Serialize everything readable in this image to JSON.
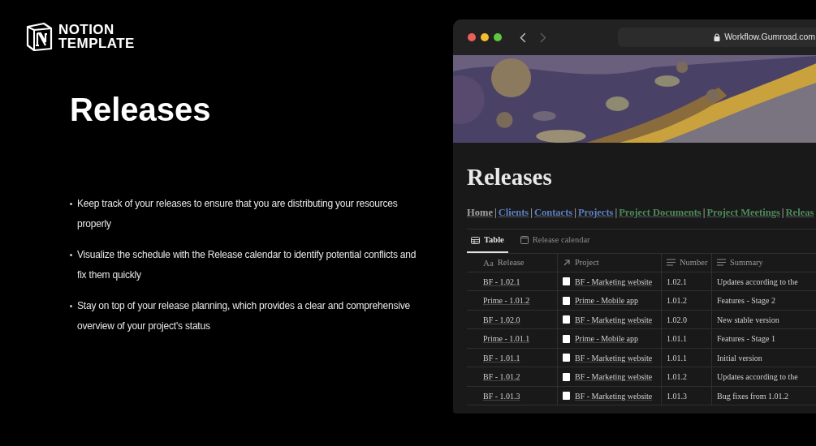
{
  "brand": {
    "lines": [
      "NOTION",
      "TEMPLATE"
    ]
  },
  "headline": "Releases",
  "bullets": [
    "Keep track of your releases to ensure that you are distributing your resources properly",
    "Visualize the schedule with the Release calendar to identify potential conflicts and fix them quickly",
    "Stay on top of your release planning, which provides a clear and comprehensive overview of your project's status"
  ],
  "browser": {
    "url": "Workflow.Gumroad.com",
    "page": {
      "title": "Releases",
      "nav": [
        {
          "kind": "link",
          "label": "Home",
          "color": "#a3a3a3"
        },
        {
          "kind": "separator",
          "label": "|"
        },
        {
          "kind": "link",
          "label": "Clients",
          "color": "#5b7fc0"
        },
        {
          "kind": "separator",
          "label": "|"
        },
        {
          "kind": "link",
          "label": "Contacts",
          "color": "#5b7fc0"
        },
        {
          "kind": "separator",
          "label": "|"
        },
        {
          "kind": "link",
          "label": "Projects",
          "color": "#5b7fc0"
        },
        {
          "kind": "separator",
          "label": "|"
        },
        {
          "kind": "link",
          "label": "Project Documents",
          "color": "#4e8a5c"
        },
        {
          "kind": "separator",
          "label": "|"
        },
        {
          "kind": "link",
          "label": "Project Meetings",
          "color": "#4e8a5c"
        },
        {
          "kind": "separator",
          "label": "|"
        },
        {
          "kind": "link",
          "label": "Releas",
          "color": "#4e8a5c"
        }
      ],
      "tabs": [
        {
          "label": "Table",
          "kind": "table",
          "selected": true
        },
        {
          "label": "Release calendar",
          "kind": "calendar",
          "selected": false
        }
      ],
      "table": {
        "columns": [
          {
            "label": "Release",
            "kind": "title",
            "glyph": "Aa"
          },
          {
            "label": "Project",
            "kind": "relation"
          },
          {
            "label": "Number",
            "kind": "text"
          },
          {
            "label": "Summary",
            "kind": "text"
          }
        ],
        "rows": [
          [
            "BF - 1.02.1",
            "BF - Marketing website",
            "1.02.1",
            "Updates according to the"
          ],
          [
            "Prime - 1.01.2",
            "Prime - Mobile app",
            "1.01.2",
            "Features - Stage 2"
          ],
          [
            "BF - 1.02.0",
            "BF - Marketing website",
            "1.02.0",
            "New stable version"
          ],
          [
            "Prime - 1.01.1",
            "Prime - Mobile app",
            "1.01.1",
            "Features - Stage 1"
          ],
          [
            "BF - 1.01.1",
            "BF - Marketing website",
            "1.01.1",
            "Initial version"
          ],
          [
            "BF - 1.01.2",
            "BF - Marketing website",
            "1.01.2",
            "Updates according to the"
          ],
          [
            "BF - 1.01.3",
            "BF - Marketing website",
            "1.01.3",
            "Bug fixes from 1.01.2"
          ]
        ]
      }
    }
  }
}
